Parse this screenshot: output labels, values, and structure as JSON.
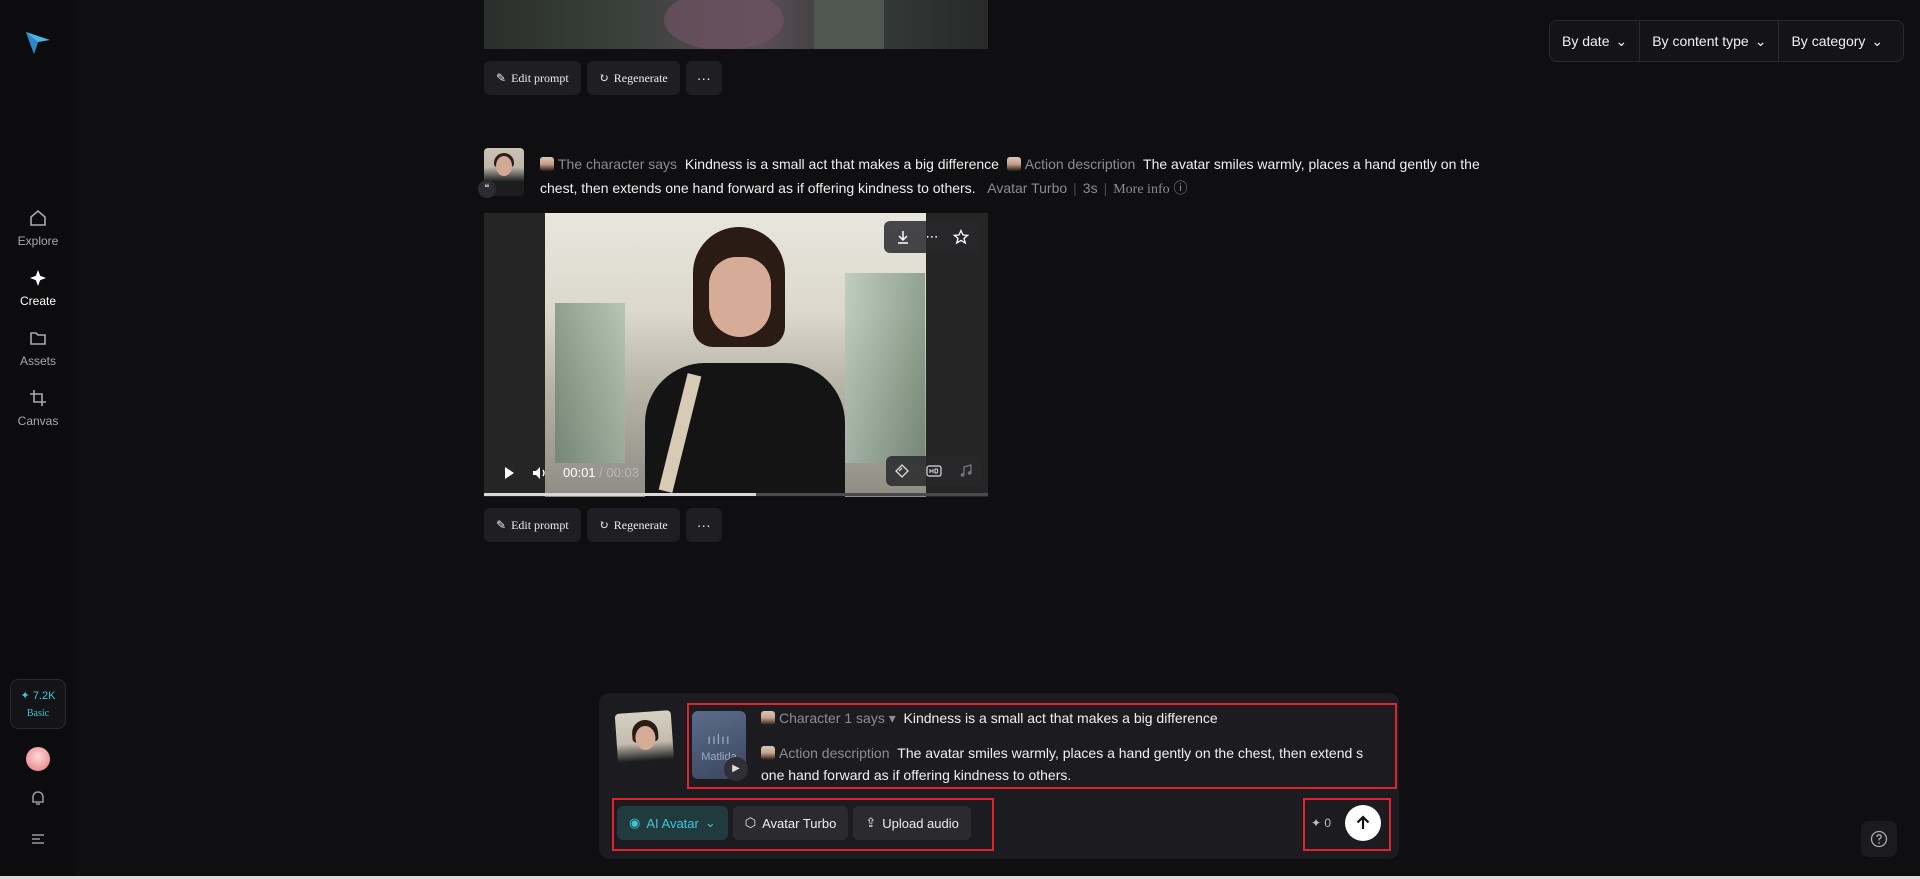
{
  "sidebar": {
    "items": [
      {
        "label": "Explore",
        "icon": "home-icon"
      },
      {
        "label": "Create",
        "icon": "sparkle-icon"
      },
      {
        "label": "Assets",
        "icon": "folder-icon"
      },
      {
        "label": "Canvas",
        "icon": "crop-icon"
      }
    ],
    "credits": "7.2K",
    "plan": "Basic"
  },
  "filters": {
    "by_date": "By date",
    "by_content_type": "By content type",
    "by_category": "By category"
  },
  "actions": {
    "edit_prompt": "Edit prompt",
    "regenerate": "Regenerate",
    "more": "···"
  },
  "post": {
    "says_label": "The character says",
    "says_text": "Kindness is a small act that makes a big difference",
    "action_label": "Action description",
    "action_text": "The avatar smiles warmly, places a hand gently on the chest, then extends one hand forward as if offering kindness to others.",
    "model": "Avatar Turbo",
    "duration": "3s",
    "more_info": "More info"
  },
  "video": {
    "current_time": "00:01",
    "duration": "/ 00:03",
    "progress": 0.54
  },
  "composer": {
    "audio_label": "Matlida",
    "character_label": "Character 1 says",
    "character_text": "Kindness is a small act that makes a big difference",
    "action_label": "Action description",
    "action_text": "The avatar smiles warmly, places a hand gently on the chest, then extend s one hand forward as if offering kindness to others.",
    "mode": "AI Avatar",
    "model": "Avatar Turbo",
    "upload": "Upload audio",
    "cost": "0"
  },
  "colors": {
    "accent": "#3ec6d6",
    "highlight": "#e0242f",
    "background": "#0f0f11"
  }
}
